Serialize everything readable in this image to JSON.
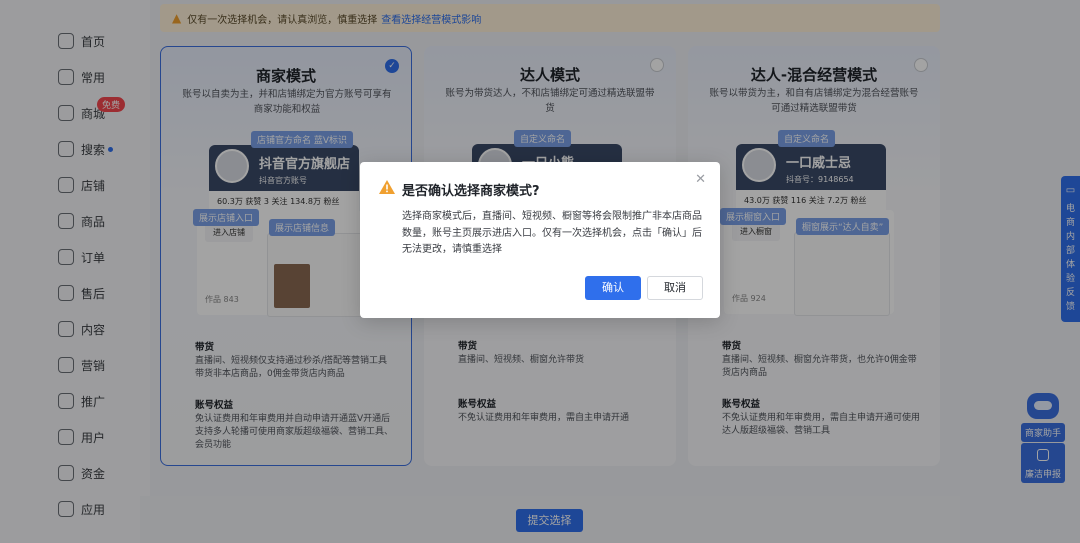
{
  "sidebar": {
    "items": [
      {
        "label": "首页"
      },
      {
        "label": "常用"
      },
      {
        "label": "商城"
      },
      {
        "label": "搜索"
      },
      {
        "label": "店铺"
      },
      {
        "label": "商品"
      },
      {
        "label": "订单"
      },
      {
        "label": "售后"
      },
      {
        "label": "内容"
      },
      {
        "label": "营销"
      },
      {
        "label": "推广"
      },
      {
        "label": "用户"
      },
      {
        "label": "资金"
      },
      {
        "label": "应用"
      }
    ],
    "mall_badge": "免费"
  },
  "notice": {
    "text": "仅有一次选择机会，请认真浏览，慎重选择",
    "link": "查看选择经营模式影响"
  },
  "cards": [
    {
      "title": "商家模式",
      "desc": "账号以自卖为主，并和店铺绑定为官方账号可享有商家功能和权益",
      "tag_top": "店铺官方命名 蓝V标识",
      "banner_name": "抖音官方旗舰店",
      "banner_sub": "抖音官方账号",
      "stats": "60.3万 获赞   3 关注   134.8万 粉丝",
      "tag_left": "展示店铺入口",
      "tag_mid": "展示店铺信息",
      "shop_label": "进入店铺",
      "works": "作品 843",
      "goods_title": "带货",
      "goods_text": "直播间、短视频仅支持通过秒杀/搭配等营销工具带货非本店商品，0佣金带货店内商品",
      "rights_title": "账号权益",
      "rights_text": "免认证费用和年审费用并自动申请开通蓝V开通后支持多人轮播可使用商家版超级福袋、营销工具、会员功能"
    },
    {
      "title": "达人模式",
      "desc": "账号为带货达人，不和店铺绑定可通过精选联盟带货",
      "tag_top": "自定义命名",
      "banner_name": "一只小熊",
      "goods_title": "带货",
      "goods_text": "直播间、短视频、橱窗允许带货",
      "rights_title": "账号权益",
      "rights_text": "不免认证费用和年审费用，需自主申请开通"
    },
    {
      "title": "达人-混合经营模式",
      "desc": "账号以带货为主，和自有店铺绑定为混合经营账号可通过精选联盟带货",
      "tag_top": "自定义命名",
      "banner_name": "一口威士忌",
      "banner_sub": "抖音号：9148654",
      "stats": "43.0万 获赞   116 关注   7.2万 粉丝",
      "tag_left": "展示橱窗入口",
      "tag_mid": "橱窗展示“达人自卖”",
      "shop_label": "进入橱窗",
      "works": "作品 924",
      "goods_title": "带货",
      "goods_text": "直播间、短视频、橱窗允许带货，也允许0佣金带货店内商品",
      "rights_title": "账号权益",
      "rights_text": "不免认证费用和年审费用，需自主申请开通可使用达人版超级福袋、营销工具"
    }
  ],
  "submit_label": "提交选择",
  "feedback_label": "电商内部体验反馈",
  "assistant": {
    "label": "商家助手",
    "report": "廉洁申报"
  },
  "modal": {
    "title": "是否确认选择商家模式?",
    "body": "选择商家模式后，直播间、短视频、橱窗等将会限制推广非本店商品数量，账号主页展示进店入口。仅有一次选择机会，点击「确认」后无法更改，请慎重选择",
    "confirm": "确认",
    "cancel": "取消"
  },
  "colors": {
    "accent": "#2f6fec",
    "warning": "#f0a030",
    "notice_bg": "#fdf0d8"
  }
}
